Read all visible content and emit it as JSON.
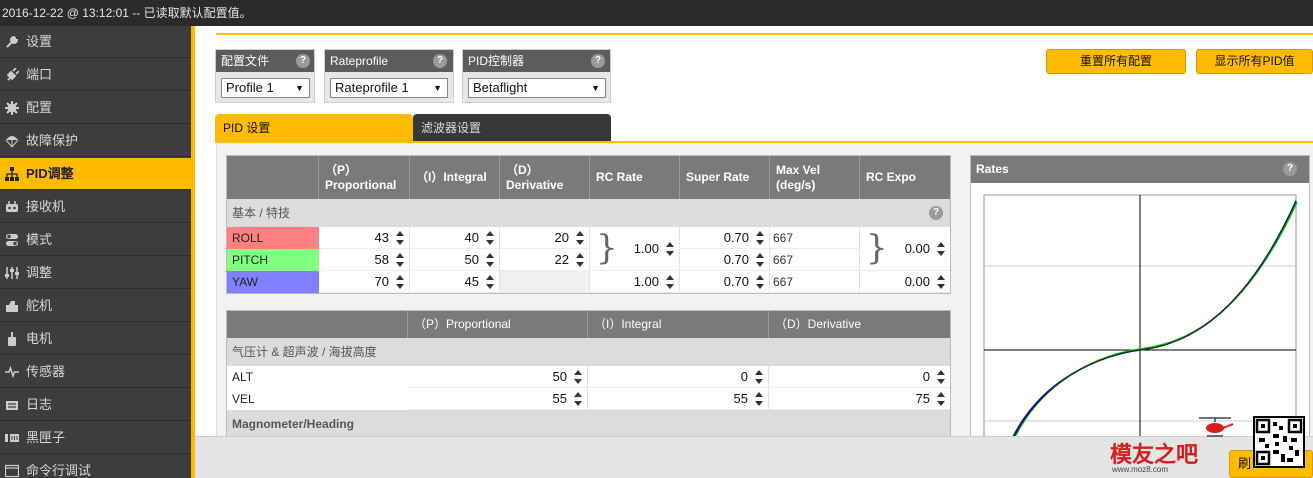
{
  "status": {
    "text": "2016-12-22 @ 13:12:01 -- 已读取默认配置值。"
  },
  "sidebar": {
    "items": [
      {
        "label": "设置",
        "icon": "wrench-icon"
      },
      {
        "label": "端口",
        "icon": "plug-icon"
      },
      {
        "label": "配置",
        "icon": "gear-icon"
      },
      {
        "label": "故障保护",
        "icon": "parachute-icon"
      },
      {
        "label": "PID调整",
        "icon": "sitemap-icon",
        "active": true
      },
      {
        "label": "接收机",
        "icon": "receiver-icon"
      },
      {
        "label": "模式",
        "icon": "switch-icon"
      },
      {
        "label": "调整",
        "icon": "sliders-icon"
      },
      {
        "label": "舵机",
        "icon": "servo-icon"
      },
      {
        "label": "电机",
        "icon": "motor-icon"
      },
      {
        "label": "传感器",
        "icon": "pulse-icon"
      },
      {
        "label": "日志",
        "icon": "log-icon"
      },
      {
        "label": "黑匣子",
        "icon": "blackbox-icon"
      },
      {
        "label": "命令行调试",
        "icon": "terminal-icon"
      }
    ]
  },
  "selectors": {
    "profile": {
      "title": "配置文件",
      "value": "Profile 1"
    },
    "rateprofile": {
      "title": "Rateprofile",
      "value": "Rateprofile 1"
    },
    "controller": {
      "title": "PID控制器",
      "value": "Betaflight"
    }
  },
  "buttons": {
    "reset": "重置所有配置",
    "show_all": "显示所有PID值",
    "save": "刷"
  },
  "tabs": {
    "pid": "PID 设置",
    "filter": "滤波器设置"
  },
  "table1": {
    "headers": {
      "p1": "（P）",
      "p2": "Proportional",
      "i": "（I）Integral",
      "d1": "（D）",
      "d2": "Derivative",
      "rc_rate": "RC Rate",
      "super_rate": "Super Rate",
      "max_vel1": "Max Vel",
      "max_vel2": "(deg/s)",
      "rc_expo": "RC Expo"
    },
    "subhead": "基本 / 特技",
    "rows": [
      {
        "name": "ROLL",
        "color": "#ff8080",
        "p": "43",
        "i": "40",
        "d": "20",
        "super_rate": "0.70",
        "max_vel": "667"
      },
      {
        "name": "PITCH",
        "color": "#80ff80",
        "p": "58",
        "i": "50",
        "d": "22",
        "super_rate": "0.70",
        "max_vel": "667"
      },
      {
        "name": "YAW",
        "color": "#8080ff",
        "p": "70",
        "i": "45",
        "rc_rate": "1.00",
        "super_rate": "0.70",
        "max_vel": "667",
        "rc_expo": "0.00"
      }
    ],
    "rc_rate_rp": "1.00",
    "rc_expo_rp": "0.00"
  },
  "table2": {
    "headers": {
      "p": "（P）Proportional",
      "i": "（I）Integral",
      "d": "（D）Derivative"
    },
    "subhead": "气压计 & 超声波 / 海拔高度",
    "rows": [
      {
        "name": "ALT",
        "p": "50",
        "i": "0",
        "d": "0"
      },
      {
        "name": "VEL",
        "p": "55",
        "i": "55",
        "d": "75"
      }
    ],
    "subhead2": "Magnometer/Heading"
  },
  "rates": {
    "title": "Rates"
  },
  "watermark": {
    "text": "模友之吧",
    "url": "www.moz8.com"
  }
}
